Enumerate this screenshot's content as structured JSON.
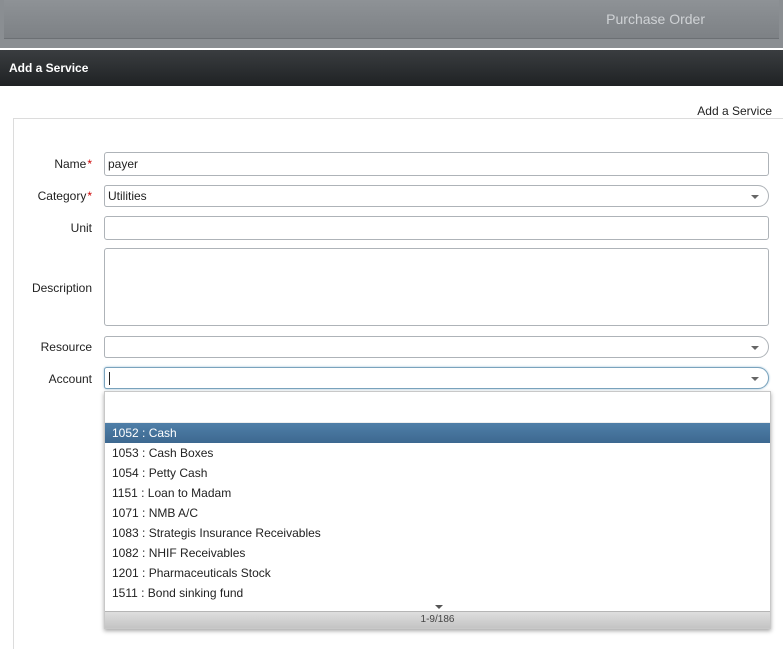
{
  "header": {
    "title": "Purchase Order"
  },
  "window": {
    "title": "Add a Service"
  },
  "content": {
    "link": "Add a Service"
  },
  "form": {
    "name": {
      "label": "Name",
      "required": "*",
      "value": "payer"
    },
    "category": {
      "label": "Category",
      "required": "*",
      "value": "Utilities"
    },
    "unit": {
      "label": "Unit",
      "value": ""
    },
    "description": {
      "label": "Description",
      "value": ""
    },
    "resource": {
      "label": "Resource",
      "value": ""
    },
    "account": {
      "label": "Account",
      "value": ""
    }
  },
  "dropdown": {
    "items": [
      "1052 : Cash",
      "1053 : Cash Boxes",
      "1054 : Petty Cash",
      "1151 : Loan to Madam",
      "1071 : NMB A/C",
      "1083 : Strategis Insurance Receivables",
      "1082 : NHIF Receivables",
      "1201 : Pharmaceuticals Stock",
      "1511 : Bond sinking fund"
    ],
    "selected_index": 0,
    "pager": "1-9/186"
  },
  "colors": {
    "selected": "#3d6890",
    "required": "#cc0000",
    "titlebar": "#1f2224"
  }
}
